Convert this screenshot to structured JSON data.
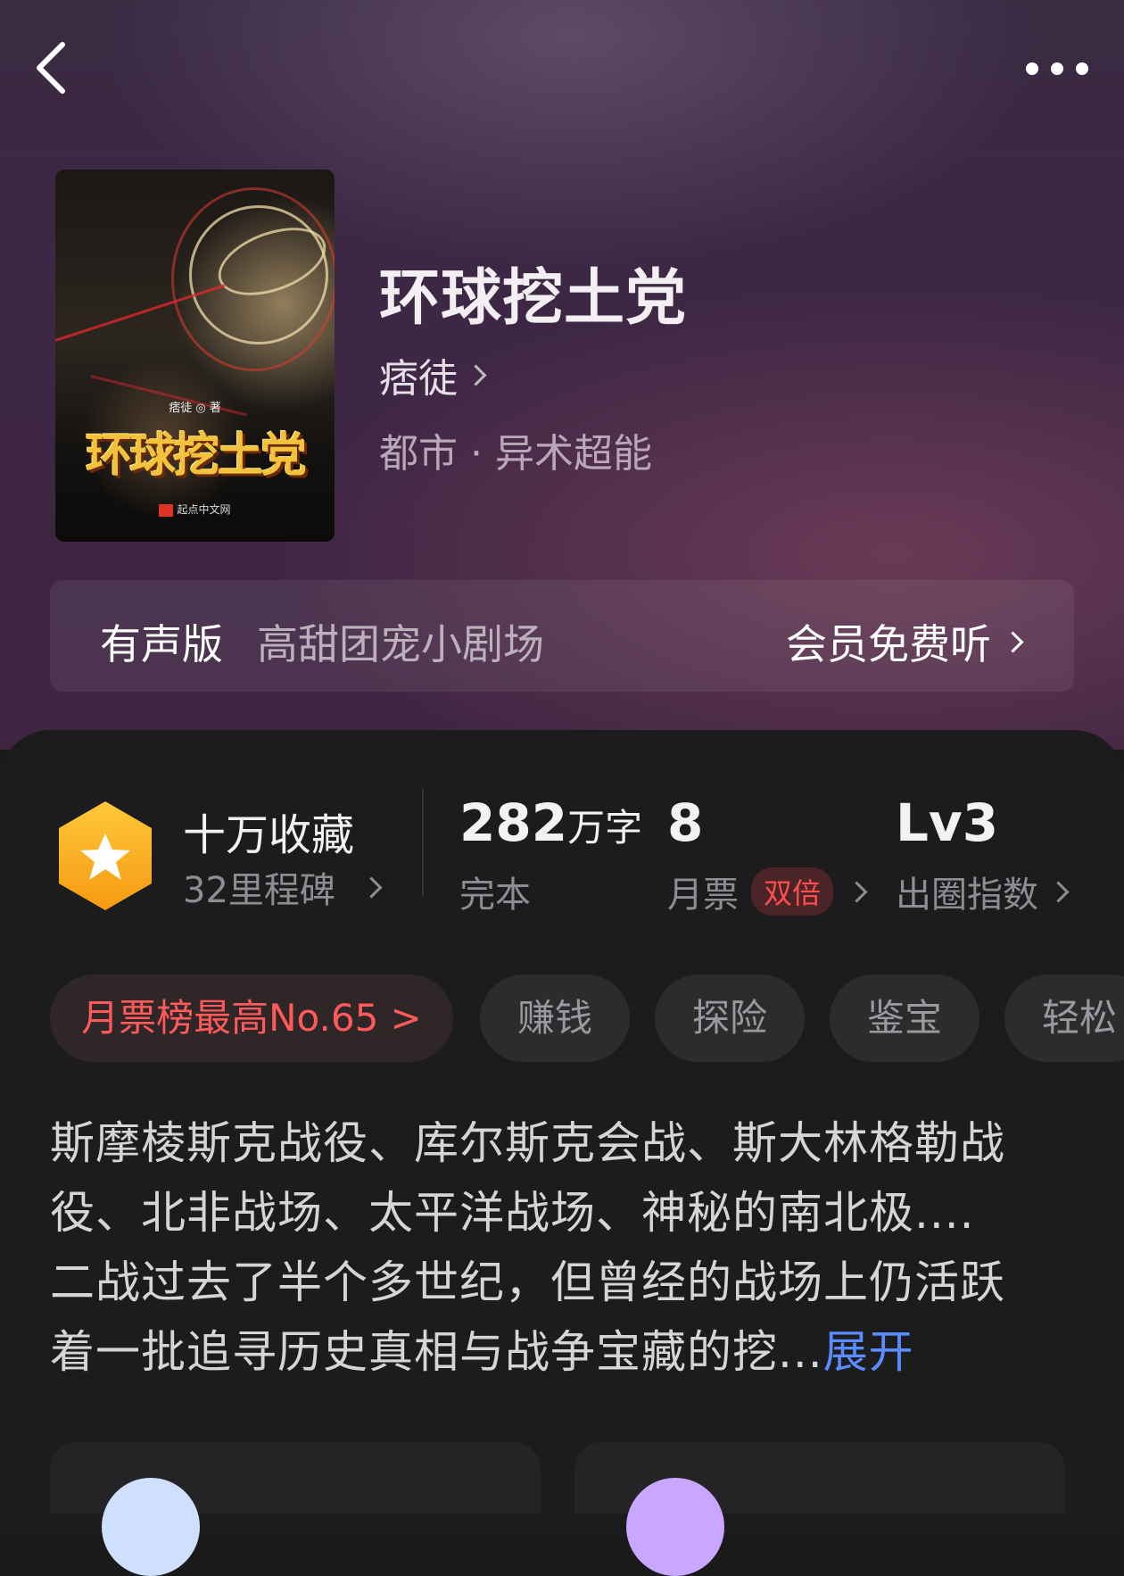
{
  "nav": {
    "back_icon": "back-arrow-icon",
    "more_icon": "more-dots-icon"
  },
  "book": {
    "title": "环球挖土党",
    "author": "痞徒",
    "genre": "都市 · 异术超能",
    "cover": {
      "title_text": "环球挖土党",
      "author_text": "痞徒 ◎ 著",
      "publisher_text": "起点中文网"
    }
  },
  "audio": {
    "label": "有声版",
    "description": "高甜团宠小剧场",
    "cta": "会员免费听"
  },
  "stats": {
    "badge_icon": "star-hexagon-icon",
    "collect_title": "十万收藏",
    "milestone": "32里程碑",
    "word_count_value": "282",
    "word_count_unit": "万字",
    "word_count_label": "完本",
    "monthly_ticket_value": "8",
    "monthly_ticket_label": "月票",
    "monthly_ticket_badge": "双倍",
    "influence_value": "Lv3",
    "influence_label": "出圈指数"
  },
  "tags": [
    "月票榜最高No.65 >",
    "赚钱",
    "探险",
    "鉴宝",
    "轻松"
  ],
  "description": {
    "lines": [
      "斯摩棱斯克战役、库尔斯克会战、斯大林格勒战",
      "役、北非战场、太平洋战场、神秘的南北极....",
      "二战过去了半个多世纪，但曾经的战场上仍活跃"
    ],
    "last_line": "着一批追寻历史真相与战争宝藏的挖...",
    "expand": "展开"
  },
  "colors": {
    "accent_blue": "#5a8cff",
    "rank_red": "#ff5a5a",
    "badge_gold": "#f7b21f"
  }
}
